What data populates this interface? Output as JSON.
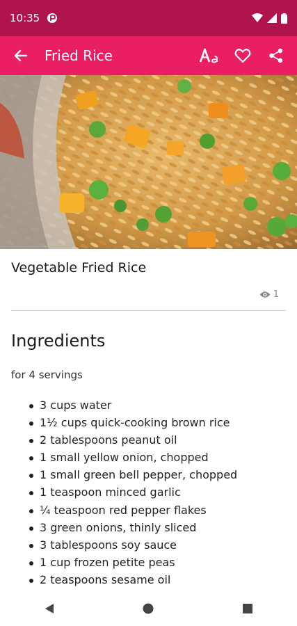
{
  "status_bar": {
    "time": "10:35"
  },
  "app_bar": {
    "title": "Fried Rice"
  },
  "recipe": {
    "title": "Vegetable Fried Rice",
    "views": "1",
    "section_title": "Ingredients",
    "servings": "for 4 servings",
    "ingredients": [
      "3 cups water",
      "1½ cups quick-cooking brown rice",
      "2 tablespoons peanut oil",
      "1 small yellow onion, chopped",
      "1 small green bell pepper, chopped",
      "1 teaspoon minced garlic",
      "¼ teaspoon red pepper flakes",
      "3 green onions, thinly sliced",
      "3 tablespoons soy sauce",
      "1 cup frozen petite peas",
      "2 teaspoons sesame oil"
    ]
  },
  "colors": {
    "status_bar": "#b0144f",
    "app_bar": "#e91e63"
  }
}
